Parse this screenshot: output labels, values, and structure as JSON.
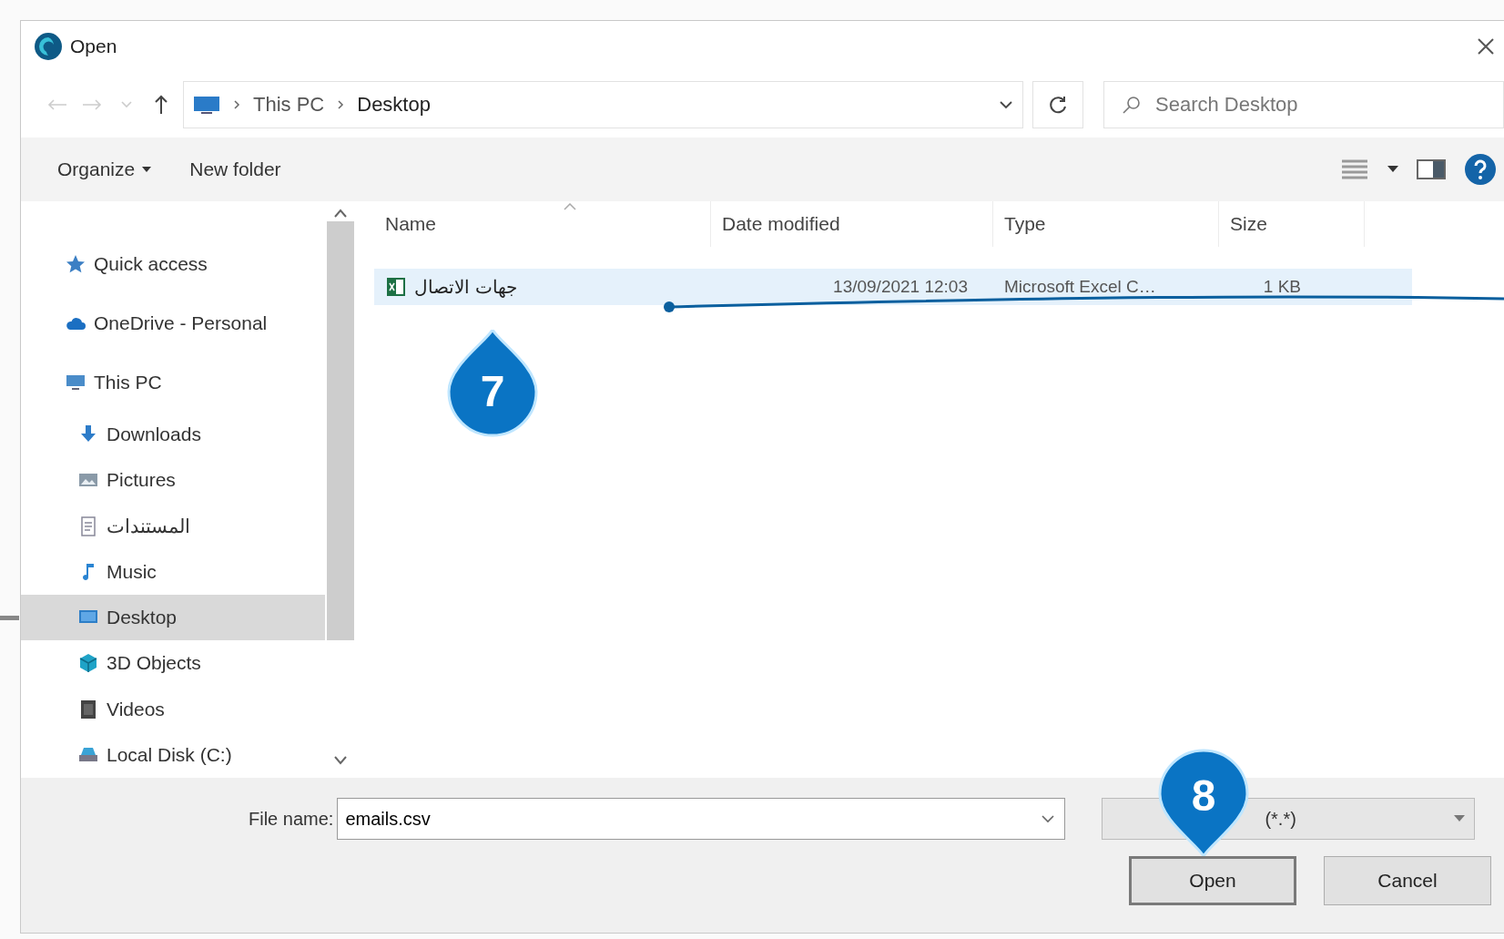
{
  "window": {
    "title": "Open"
  },
  "address": {
    "path": [
      "This PC",
      "Desktop"
    ]
  },
  "search": {
    "placeholder": "Search Desktop"
  },
  "toolbar": {
    "buttons": [
      {
        "label": "Organize",
        "kind": "menu"
      },
      {
        "label": "New folder",
        "kind": "plain"
      }
    ]
  },
  "sidebar": {
    "items": [
      {
        "label": "Quick access",
        "kind": "star",
        "selected": false
      },
      {
        "label": "OneDrive - Personal",
        "kind": "cloud",
        "selected": false
      },
      {
        "label": "This PC",
        "kind": "pc",
        "selected": false,
        "children": [
          {
            "label": "Downloads",
            "kind": "download",
            "selected": false
          },
          {
            "label": "Pictures",
            "kind": "pictures",
            "selected": false
          },
          {
            "label": "المستندات",
            "kind": "document",
            "selected": false
          },
          {
            "label": "Music",
            "kind": "music",
            "selected": false
          },
          {
            "label": "Desktop",
            "kind": "desktop",
            "selected": true
          },
          {
            "label": "3D Objects",
            "kind": "cube",
            "selected": false
          },
          {
            "label": "Videos",
            "kind": "video",
            "selected": false
          },
          {
            "label": "Local Disk (C:)",
            "kind": "disk",
            "selected": false
          }
        ]
      }
    ]
  },
  "table": {
    "columns": [
      "Name",
      "Date modified",
      "Type",
      "Size"
    ],
    "rows": [
      {
        "name": "جهات الاتصال",
        "date": "13/09/2021 12:03",
        "type": "Microsoft Excel C…",
        "size": "1 KB",
        "kind": "excel",
        "selected": true
      }
    ]
  },
  "file_name": {
    "label": "File name:",
    "value": "emails.csv"
  },
  "file_type": {
    "value": "(*.*)"
  },
  "buttons": [
    {
      "label": "Open",
      "focused": true
    },
    {
      "label": "Cancel",
      "focused": false
    }
  ],
  "markers": [
    {
      "label": "7",
      "kind": "up"
    },
    {
      "label": "8",
      "kind": "down"
    }
  ]
}
